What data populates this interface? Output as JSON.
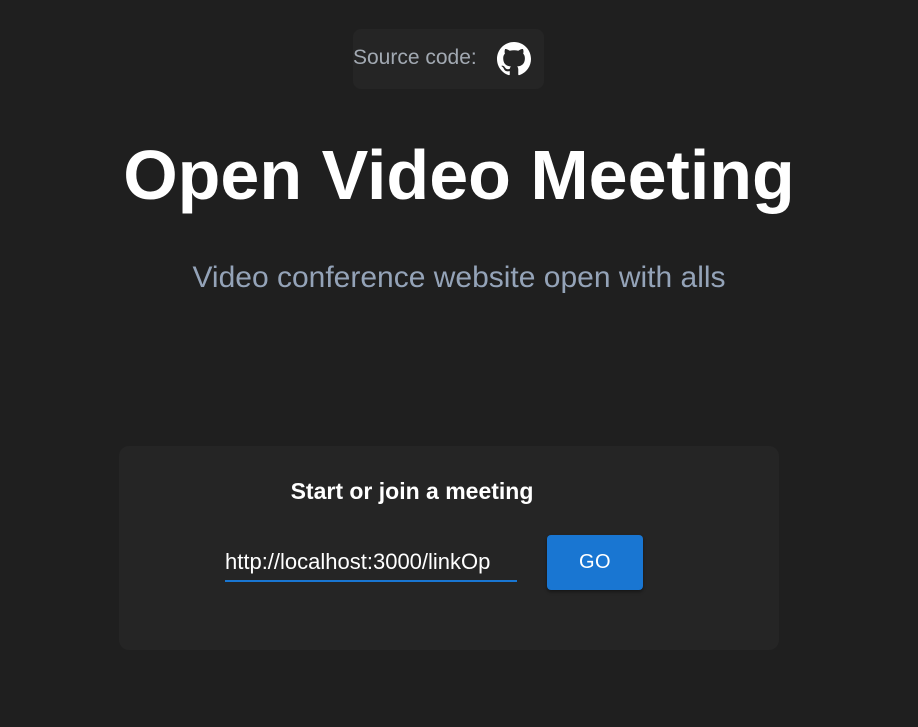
{
  "header": {
    "source_label": "Source code:",
    "github_icon": "github-icon"
  },
  "hero": {
    "title": "Open Video Meeting",
    "subtitle": "Video conference website open with alls"
  },
  "meeting": {
    "heading": "Start or join a meeting",
    "input_value": "http://localhost:3000/linkOp",
    "go_label": "GO"
  },
  "colors": {
    "background": "#1f1f1f",
    "card": "#252525",
    "accent": "#1976d2",
    "subtitle": "#94a3b8"
  }
}
